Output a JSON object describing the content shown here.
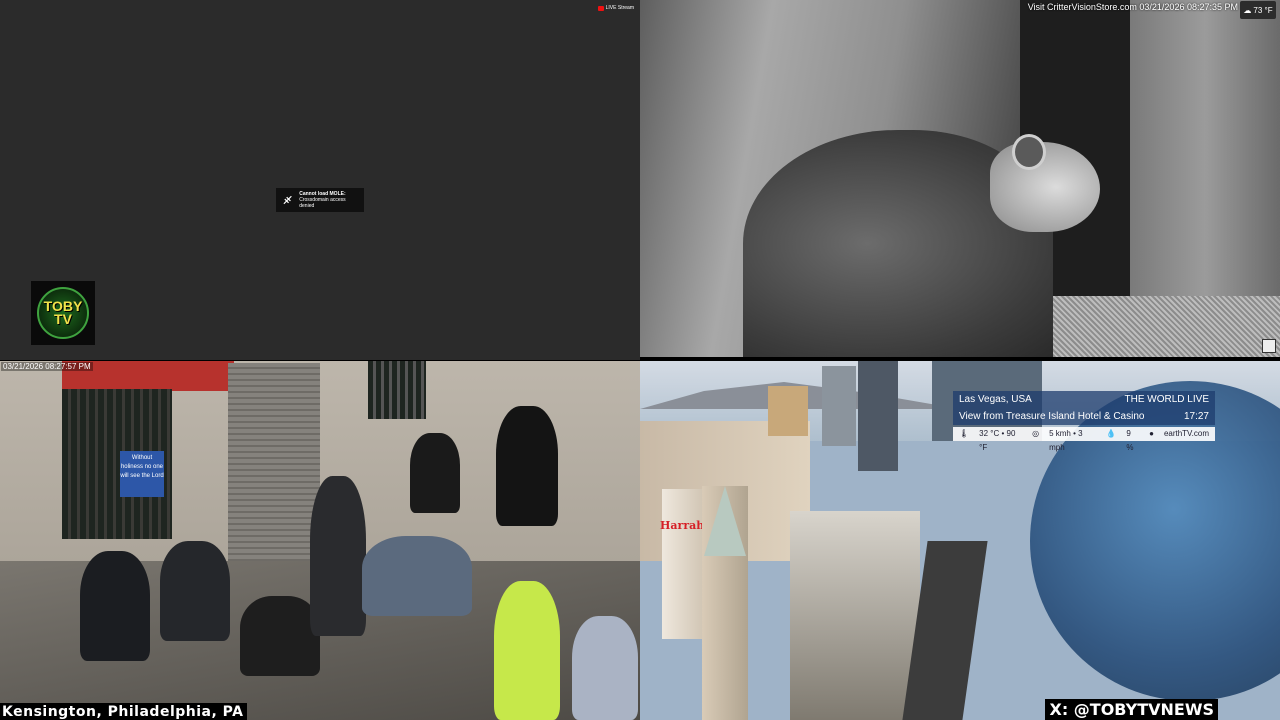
{
  "q1": {
    "live_badge": "LIVE Stream",
    "error_title": "Cannot load MOLE:",
    "error_detail": "Crossdomain access denied",
    "logo_line1": "TOBY",
    "logo_line2": "TV"
  },
  "q2": {
    "timestamp": "Visit CritterVisionStore.com 03/21/2026 08:27:35 PM",
    "temperature": "73 °F"
  },
  "q3": {
    "timestamp": "03/21/2026 08:27:57 PM",
    "location": "Kensington, Philadelphia, PA",
    "sign_text": "Without holiness no one will see the Lord"
  },
  "q4": {
    "city": "Las Vegas, USA",
    "network": "THE WORLD LIVE",
    "view": "View from Treasure Island Hotel & Casino",
    "time": "17:27",
    "temps": "32 °C • 90 °F",
    "wind": "5 kmh • 3 mph",
    "humidity": "9 %",
    "brand": "earthTV.com",
    "harrahs": "Harrah's",
    "handle": "X: @TOBYTVNEWS"
  },
  "colors": {
    "awning": "#b7322d",
    "sign_blue": "#2d57a8",
    "harrahs_red": "#d61f26"
  }
}
